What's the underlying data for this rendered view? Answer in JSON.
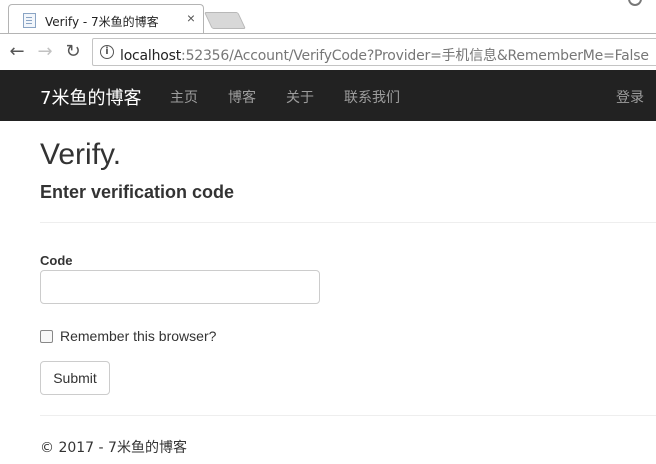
{
  "browser": {
    "tab_title": "Verify - 7米鱼的博客",
    "close_glyph": "×",
    "back_glyph": "←",
    "forward_glyph": "→",
    "reload_glyph": "↻",
    "info_glyph": "i",
    "url_host": "localhost",
    "url_rest": ":52356/Account/VerifyCode?Provider=手机信息&RememberMe=False"
  },
  "navbar": {
    "brand": "7米鱼的博客",
    "links": [
      "主页",
      "博客",
      "关于",
      "联系我们"
    ],
    "login": "登录"
  },
  "page": {
    "title": "Verify.",
    "subtitle": "Enter verification code",
    "code_label": "Code",
    "code_value": "",
    "remember_label": "Remember this browser?",
    "remember_checked": false,
    "submit_label": "Submit"
  },
  "footer": {
    "text": "© 2017 - 7米鱼的博客"
  },
  "colors": {
    "navbar_bg": "#222222",
    "navbar_link": "#9d9d9d",
    "text": "#333333"
  }
}
